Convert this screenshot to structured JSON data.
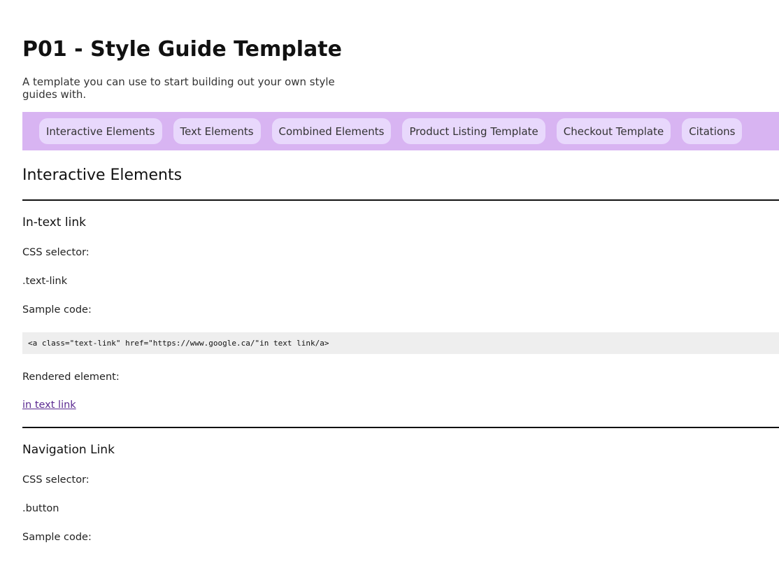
{
  "title": "P01 - Style Guide Template",
  "subtitle": "A template you can use to start building out your own style guides with.",
  "nav": [
    "Interactive Elements",
    "Text Elements",
    "Combined Elements",
    "Product Listing Template",
    "Checkout Template",
    "Citations"
  ],
  "section_title": "Interactive Elements",
  "in_text_link": {
    "heading": "In-text link",
    "selector_label": "CSS selector:",
    "selector": ".text-link",
    "sample_label": "Sample code:",
    "code": "<a class=\"text-link\" href=\"https://www.google.ca/\"in text link/a>",
    "rendered_label": "Rendered element:",
    "link_text": "in text link"
  },
  "navigation_link": {
    "heading": "Navigation Link",
    "selector_label": "CSS selector:",
    "selector": ".button",
    "sample_label": "Sample code:"
  },
  "colors": {
    "nav_bg": "#d8b4f2",
    "pill_bg": "#e8d8fc",
    "link": "#5b2a91",
    "code_bg": "#eeeeee"
  }
}
